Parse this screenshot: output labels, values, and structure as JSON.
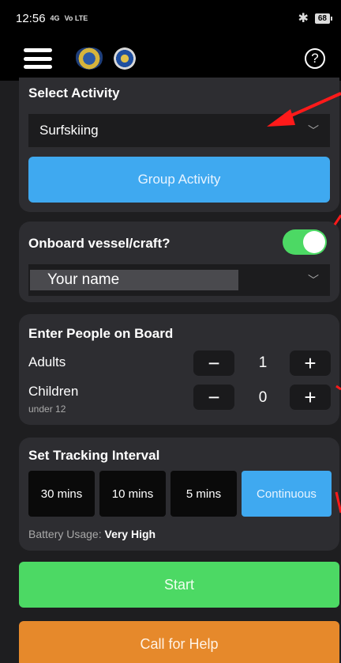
{
  "status_bar": {
    "time": "12:56",
    "network": "4G",
    "network_type": "Vo LTE",
    "battery": "68"
  },
  "header": {
    "help_glyph": "?"
  },
  "activity": {
    "title": "Select Activity",
    "selected": "Surfskiing",
    "group_button": "Group Activity"
  },
  "vessel": {
    "title": "Onboard vessel/craft?",
    "toggle_on": true,
    "name_value": "Your name"
  },
  "people": {
    "title": "Enter People on Board",
    "adults_label": "Adults",
    "adults_value": "1",
    "children_label": "Children",
    "children_sub": "under 12",
    "children_value": "0",
    "minus": "−",
    "plus": "+"
  },
  "interval": {
    "title": "Set Tracking Interval",
    "options": [
      "30 mins",
      "10 mins",
      "5 mins",
      "Continuous"
    ],
    "selected": "Continuous",
    "battery_label": "Battery Usage:",
    "battery_value": "Very High"
  },
  "actions": {
    "start": "Start",
    "call_help": "Call for Help"
  },
  "colors": {
    "accent_blue": "#3fa9f0",
    "start_green": "#4cd964",
    "help_orange": "#e6892b",
    "annotation_red": "#ff1a1a"
  }
}
